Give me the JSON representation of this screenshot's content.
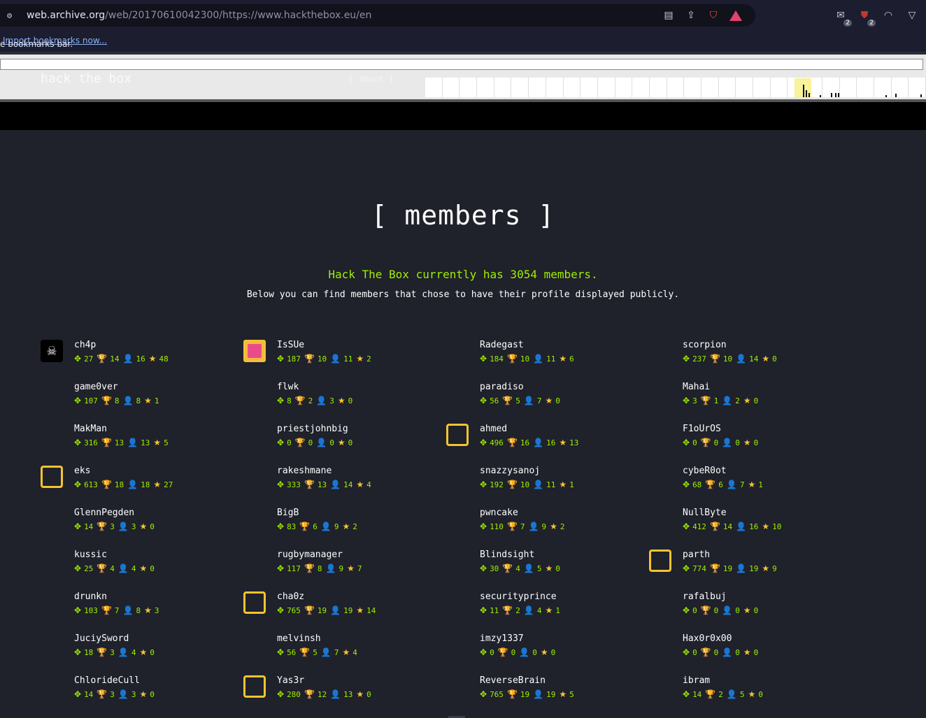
{
  "browser": {
    "url_host": "web.archive.org",
    "url_path": "/web/20170610042300/https://www.hackthebox.eu/en",
    "bookmarks_text": "e bookmarks bar.",
    "bookmarks_link": "Import bookmarks now...",
    "ext_badge_1": "2",
    "ext_badge_2": "2"
  },
  "wayback": {
    "brand": "hack the box",
    "about": "[ about ]"
  },
  "page": {
    "title": "[ members ]",
    "count_text": "Hack The Box currently has 3054 members.",
    "note": "Below you can find members that chose to have their profile displayed publicly."
  },
  "colors": {
    "accent": "#9fef00",
    "trophy": "#f4a623",
    "user": "#5bc0de",
    "star": "#f4c430",
    "bg": "#1f212b"
  },
  "members": [
    [
      {
        "name": "ch4p",
        "points": "27",
        "owns": "14",
        "users": "16",
        "respect": "48",
        "avatar": "skull"
      },
      {
        "name": "game0ver",
        "points": "107",
        "owns": "8",
        "users": "8",
        "respect": "1",
        "avatar": "none"
      },
      {
        "name": "MakMan",
        "points": "316",
        "owns": "13",
        "users": "13",
        "respect": "5",
        "avatar": "none"
      },
      {
        "name": "eks",
        "points": "613",
        "owns": "18",
        "users": "18",
        "respect": "27",
        "avatar": "frame"
      },
      {
        "name": "GlennPegden",
        "points": "14",
        "owns": "3",
        "users": "3",
        "respect": "0",
        "avatar": "none"
      },
      {
        "name": "kussic",
        "points": "25",
        "owns": "4",
        "users": "4",
        "respect": "0",
        "avatar": "none"
      },
      {
        "name": "drunkn",
        "points": "103",
        "owns": "7",
        "users": "8",
        "respect": "3",
        "avatar": "none"
      },
      {
        "name": "JuciySword",
        "points": "18",
        "owns": "3",
        "users": "4",
        "respect": "0",
        "avatar": "none"
      },
      {
        "name": "ChlorideCull",
        "points": "14",
        "owns": "3",
        "users": "3",
        "respect": "0",
        "avatar": "none"
      }
    ],
    [
      {
        "name": "IsSUe",
        "points": "187",
        "owns": "10",
        "users": "11",
        "respect": "2",
        "avatar": "pink"
      },
      {
        "name": "flwk",
        "points": "8",
        "owns": "2",
        "users": "3",
        "respect": "0",
        "avatar": "none"
      },
      {
        "name": "priestjohnbig",
        "points": "0",
        "owns": "0",
        "users": "0",
        "respect": "0",
        "avatar": "none"
      },
      {
        "name": "rakeshmane",
        "points": "333",
        "owns": "13",
        "users": "14",
        "respect": "4",
        "avatar": "none"
      },
      {
        "name": "BigB",
        "points": "83",
        "owns": "6",
        "users": "9",
        "respect": "2",
        "avatar": "none"
      },
      {
        "name": "rugbymanager",
        "points": "117",
        "owns": "8",
        "users": "9",
        "respect": "7",
        "avatar": "none"
      },
      {
        "name": "cha0z",
        "points": "765",
        "owns": "19",
        "users": "19",
        "respect": "14",
        "avatar": "frame"
      },
      {
        "name": "melvinsh",
        "points": "56",
        "owns": "5",
        "users": "7",
        "respect": "4",
        "avatar": "none"
      },
      {
        "name": "Yas3r",
        "points": "280",
        "owns": "12",
        "users": "13",
        "respect": "0",
        "avatar": "frame"
      }
    ],
    [
      {
        "name": "Radegast",
        "points": "184",
        "owns": "10",
        "users": "11",
        "respect": "6",
        "avatar": "none"
      },
      {
        "name": "paradiso",
        "points": "56",
        "owns": "5",
        "users": "7",
        "respect": "0",
        "avatar": "none"
      },
      {
        "name": "ahmed",
        "points": "496",
        "owns": "16",
        "users": "16",
        "respect": "13",
        "avatar": "frame"
      },
      {
        "name": "snazzysanoj",
        "points": "192",
        "owns": "10",
        "users": "11",
        "respect": "1",
        "avatar": "none"
      },
      {
        "name": "pwncake",
        "points": "110",
        "owns": "7",
        "users": "9",
        "respect": "2",
        "avatar": "none"
      },
      {
        "name": "Blindsight",
        "points": "30",
        "owns": "4",
        "users": "5",
        "respect": "0",
        "avatar": "none"
      },
      {
        "name": "securityprince",
        "points": "11",
        "owns": "2",
        "users": "4",
        "respect": "1",
        "avatar": "none"
      },
      {
        "name": "imzy1337",
        "points": "0",
        "owns": "0",
        "users": "0",
        "respect": "0",
        "avatar": "none"
      },
      {
        "name": "ReverseBrain",
        "points": "765",
        "owns": "19",
        "users": "19",
        "respect": "5",
        "avatar": "none"
      }
    ],
    [
      {
        "name": "scorpion",
        "points": "237",
        "owns": "10",
        "users": "14",
        "respect": "0",
        "avatar": "none"
      },
      {
        "name": "Mahai",
        "points": "3",
        "owns": "1",
        "users": "2",
        "respect": "0",
        "avatar": "none"
      },
      {
        "name": "F1oUrOS",
        "points": "0",
        "owns": "0",
        "users": "0",
        "respect": "0",
        "avatar": "none"
      },
      {
        "name": "cybeR0ot",
        "points": "68",
        "owns": "6",
        "users": "7",
        "respect": "1",
        "avatar": "none"
      },
      {
        "name": "NullByte",
        "points": "412",
        "owns": "14",
        "users": "16",
        "respect": "10",
        "avatar": "none"
      },
      {
        "name": "parth",
        "points": "774",
        "owns": "19",
        "users": "19",
        "respect": "9",
        "avatar": "frame"
      },
      {
        "name": "rafalbuj",
        "points": "0",
        "owns": "0",
        "users": "0",
        "respect": "0",
        "avatar": "none"
      },
      {
        "name": "Hax0r0x00",
        "points": "0",
        "owns": "0",
        "users": "0",
        "respect": "0",
        "avatar": "none"
      },
      {
        "name": "ibram",
        "points": "14",
        "owns": "2",
        "users": "5",
        "respect": "0",
        "avatar": "none"
      }
    ]
  ]
}
